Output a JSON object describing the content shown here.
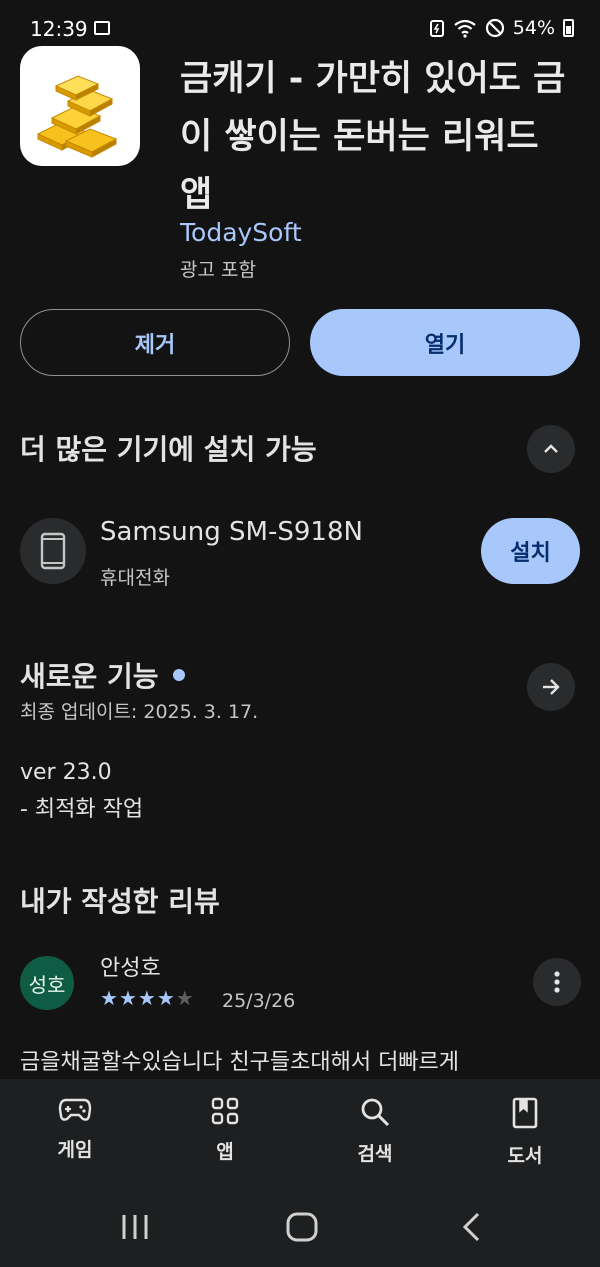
{
  "status_bar": {
    "time": "12:39",
    "battery": "54%"
  },
  "app": {
    "title": "금캐기 - 가만히 있어도 금이 쌓이는 돈버는 리워드 앱",
    "developer": "TodaySoft",
    "ads_note": "광고 포함",
    "uninstall_label": "제거",
    "open_label": "열기"
  },
  "devices": {
    "title": "더 많은 기기에 설치 가능",
    "device_name": "Samsung SM-S918N",
    "device_type": "휴대전화",
    "install_label": "설치"
  },
  "whats_new": {
    "title": "새로운 기능",
    "last_updated": "최종 업데이트: 2025. 3. 17.",
    "version": "ver 23.0",
    "note": "- 최적화 작업"
  },
  "my_review": {
    "title": "내가 작성한 리뷰",
    "avatar_text": "성호",
    "reviewer": "안성호",
    "rating": 4,
    "max_rating": 5,
    "date": "25/3/26",
    "text": "금을채굴할수있습니다 친구들초대해서 더빠르게"
  },
  "bottom_nav": [
    {
      "label": "게임",
      "icon": "gamepad-icon"
    },
    {
      "label": "앱",
      "icon": "apps-grid-icon"
    },
    {
      "label": "검색",
      "icon": "search-icon"
    },
    {
      "label": "도서",
      "icon": "book-icon"
    }
  ],
  "colors": {
    "accent": "#a8c7fa",
    "background": "#131314",
    "surface": "#1e1f20",
    "avatar": "#0f5c45"
  }
}
